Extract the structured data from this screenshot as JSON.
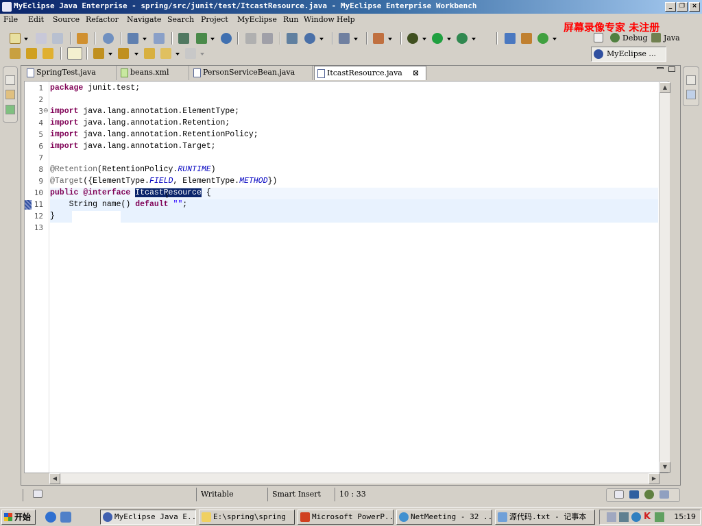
{
  "window": {
    "title": "MyEclipse Java Enterprise - spring/src/junit/test/ItcastResource.java - MyEclipse Enterprise Workbench"
  },
  "menu": [
    "File",
    "Edit",
    "Source",
    "Refactor",
    "Navigate",
    "Search",
    "Project",
    "MyEclipse",
    "Run",
    "Window",
    "Help"
  ],
  "watermark": "屏幕录像专家 未注册",
  "perspectives": {
    "debug": "Debug",
    "java": "Java",
    "myeclipse": "MyEclipse ..."
  },
  "tabs": [
    {
      "label": "SpringTest.java",
      "active": false
    },
    {
      "label": "beans.xml",
      "active": false
    },
    {
      "label": "PersonServiceBean.java",
      "active": false
    },
    {
      "label": "ItcastResource.java",
      "active": true
    }
  ],
  "code": {
    "line_numbers": [
      "1",
      "2",
      "3",
      "4",
      "5",
      "6",
      "7",
      "8",
      "9",
      "10",
      "11",
      "12",
      "13"
    ],
    "l1_kw": "package",
    "l1_rest": " junit.test;",
    "l3_kw": "import",
    "l3_rest": " java.lang.annotation.ElementType;",
    "l4_kw": "import",
    "l4_rest": " java.lang.annotation.Retention;",
    "l5_kw": "import",
    "l5_rest": " java.lang.annotation.RetentionPolicy;",
    "l6_kw": "import",
    "l6_rest": " java.lang.annotation.Target;",
    "l8_ann": "@Retention",
    "l8_a": "(RetentionPolicy.",
    "l8_fld": "RUNTIME",
    "l8_b": ")",
    "l9_ann": "@Target",
    "l9_a": "({ElementType.",
    "l9_fld1": "FIELD",
    "l9_b": ", ElementType.",
    "l9_fld2": "METHOD",
    "l9_c": "})",
    "l10_kw": "public @interface",
    "l10_space": " ",
    "l10_sel": "ItcastResource",
    "l10_rest": " {",
    "l11_a": "    String name() ",
    "l11_kw": "default",
    "l11_space": " ",
    "l11_str": "\"\"",
    "l11_rest": ";",
    "l12": "}"
  },
  "status": {
    "writable": "Writable",
    "insert_mode": "Smart Insert",
    "position": "10 : 33"
  },
  "taskbar": {
    "start": "开始",
    "tasks": [
      {
        "label": "MyEclipse Java E...",
        "active": true
      },
      {
        "label": "E:\\spring\\spring",
        "active": false
      },
      {
        "label": "Microsoft PowerP...",
        "active": false
      },
      {
        "label": "NetMeeting - 32 ...",
        "active": false
      },
      {
        "label": "源代码.txt - 记事本",
        "active": false
      }
    ],
    "clock": "15:19"
  },
  "colors": {
    "keyword": "#7f0055",
    "annotation": "#646464",
    "constant": "#0000c0",
    "string": "#2a00ff",
    "selection": "#0a246a",
    "title_bar": "#0a246a",
    "watermark": "#ff0000"
  }
}
